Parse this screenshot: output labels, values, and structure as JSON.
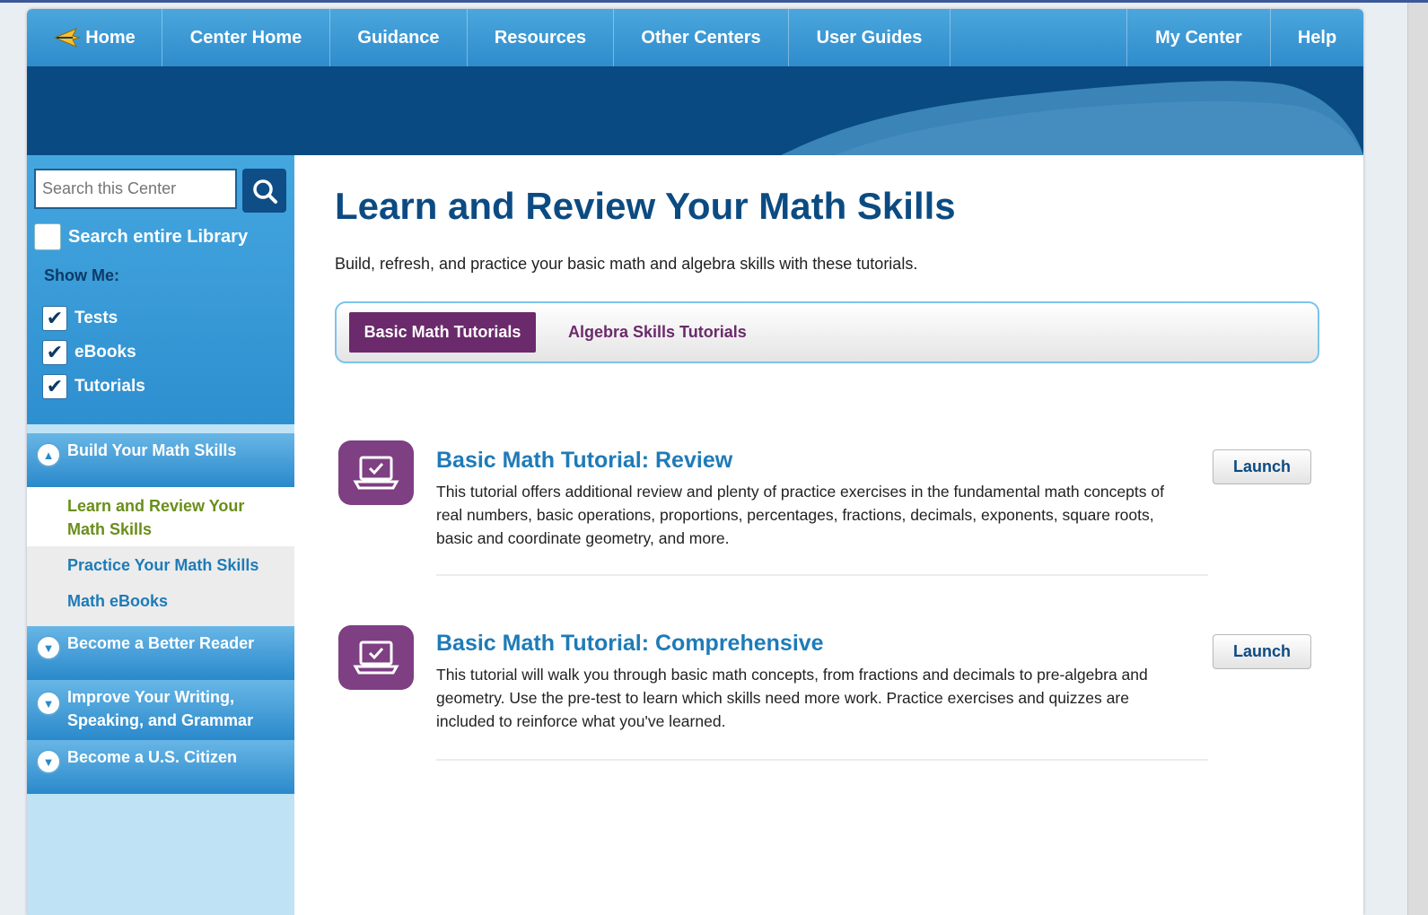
{
  "nav": {
    "home": "Home",
    "center_home": "Center Home",
    "guidance": "Guidance",
    "resources": "Resources",
    "other_centers": "Other Centers",
    "user_guides": "User Guides",
    "my_center": "My Center",
    "help": "Help"
  },
  "sidebar": {
    "search_placeholder": "Search this Center",
    "search_library_label": "Search entire Library",
    "show_me": "Show Me:",
    "filters": [
      {
        "label": "Tests",
        "checked": true
      },
      {
        "label": "eBooks",
        "checked": true
      },
      {
        "label": "Tutorials",
        "checked": true
      }
    ],
    "categories": [
      {
        "label": "Build Your Math Skills",
        "expanded": true
      },
      {
        "label": "Become a Better Reader",
        "expanded": false
      },
      {
        "label": "Improve Your Writing, Speaking, and Grammar",
        "expanded": false
      },
      {
        "label": "Become a U.S. Citizen",
        "expanded": false
      }
    ],
    "subitems": [
      {
        "label": "Learn and Review Your Math Skills",
        "selected": true
      },
      {
        "label": "Practice Your Math Skills",
        "selected": false
      },
      {
        "label": "Math eBooks",
        "selected": false
      }
    ]
  },
  "main": {
    "title": "Learn and Review Your Math Skills",
    "description": "Build, refresh, and practice your basic math and algebra skills with these tutorials.",
    "tabs": [
      {
        "label": "Basic Math Tutorials",
        "active": true
      },
      {
        "label": "Algebra Skills Tutorials",
        "active": false
      }
    ],
    "tutorials": [
      {
        "title": "Basic Math Tutorial: Review",
        "description": "This tutorial offers additional review and plenty of practice exercises in the fundamental math concepts of real numbers, basic operations, proportions, percentages, fractions, decimals, exponents, square roots, basic and coordinate geometry, and more.",
        "button": "Launch"
      },
      {
        "title": "Basic Math Tutorial: Comprehensive",
        "description": "This tutorial will walk you through basic math concepts, from fractions and decimals to pre-algebra and geometry. Use the pre-test to learn which skills need more work. Practice exercises and quizzes are included to reinforce what you've learned.",
        "button": "Launch"
      }
    ]
  },
  "colors": {
    "nav_blue": "#3399d6",
    "banner_navy": "#0a4a82",
    "title_navy": "#0c4b82",
    "tab_purple": "#6b2a6b",
    "link_blue": "#1e7bb8",
    "selected_green": "#6a8e1a"
  }
}
